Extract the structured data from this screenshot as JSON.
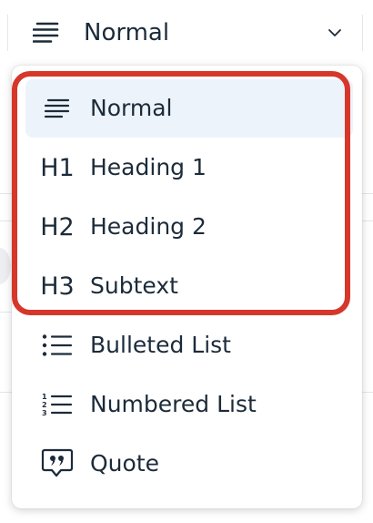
{
  "toolbar": {
    "block_type_select": {
      "icon": "paragraph-lines-icon",
      "value": "Normal",
      "chevron": "chevron-down-icon"
    }
  },
  "menu": {
    "items": [
      {
        "icon": "paragraph-lines-icon",
        "icon_text": "",
        "label": "Normal",
        "selected": true
      },
      {
        "icon": "heading-1-icon",
        "icon_text": "H1",
        "label": "Heading 1",
        "selected": false
      },
      {
        "icon": "heading-2-icon",
        "icon_text": "H2",
        "label": "Heading 2",
        "selected": false
      },
      {
        "icon": "heading-3-icon",
        "icon_text": "H3",
        "label": "Subtext",
        "selected": false
      },
      {
        "icon": "bulleted-list-icon",
        "icon_text": "",
        "label": "Bulleted List",
        "selected": false
      },
      {
        "icon": "numbered-list-icon",
        "icon_text": "",
        "label": "Numbered List",
        "selected": false
      },
      {
        "icon": "quote-icon",
        "icon_text": "",
        "label": "Quote",
        "selected": false
      }
    ]
  },
  "colors": {
    "text": "#1c2b3a",
    "selected_bg": "#edf3fa",
    "highlight_border": "#d6372a"
  }
}
